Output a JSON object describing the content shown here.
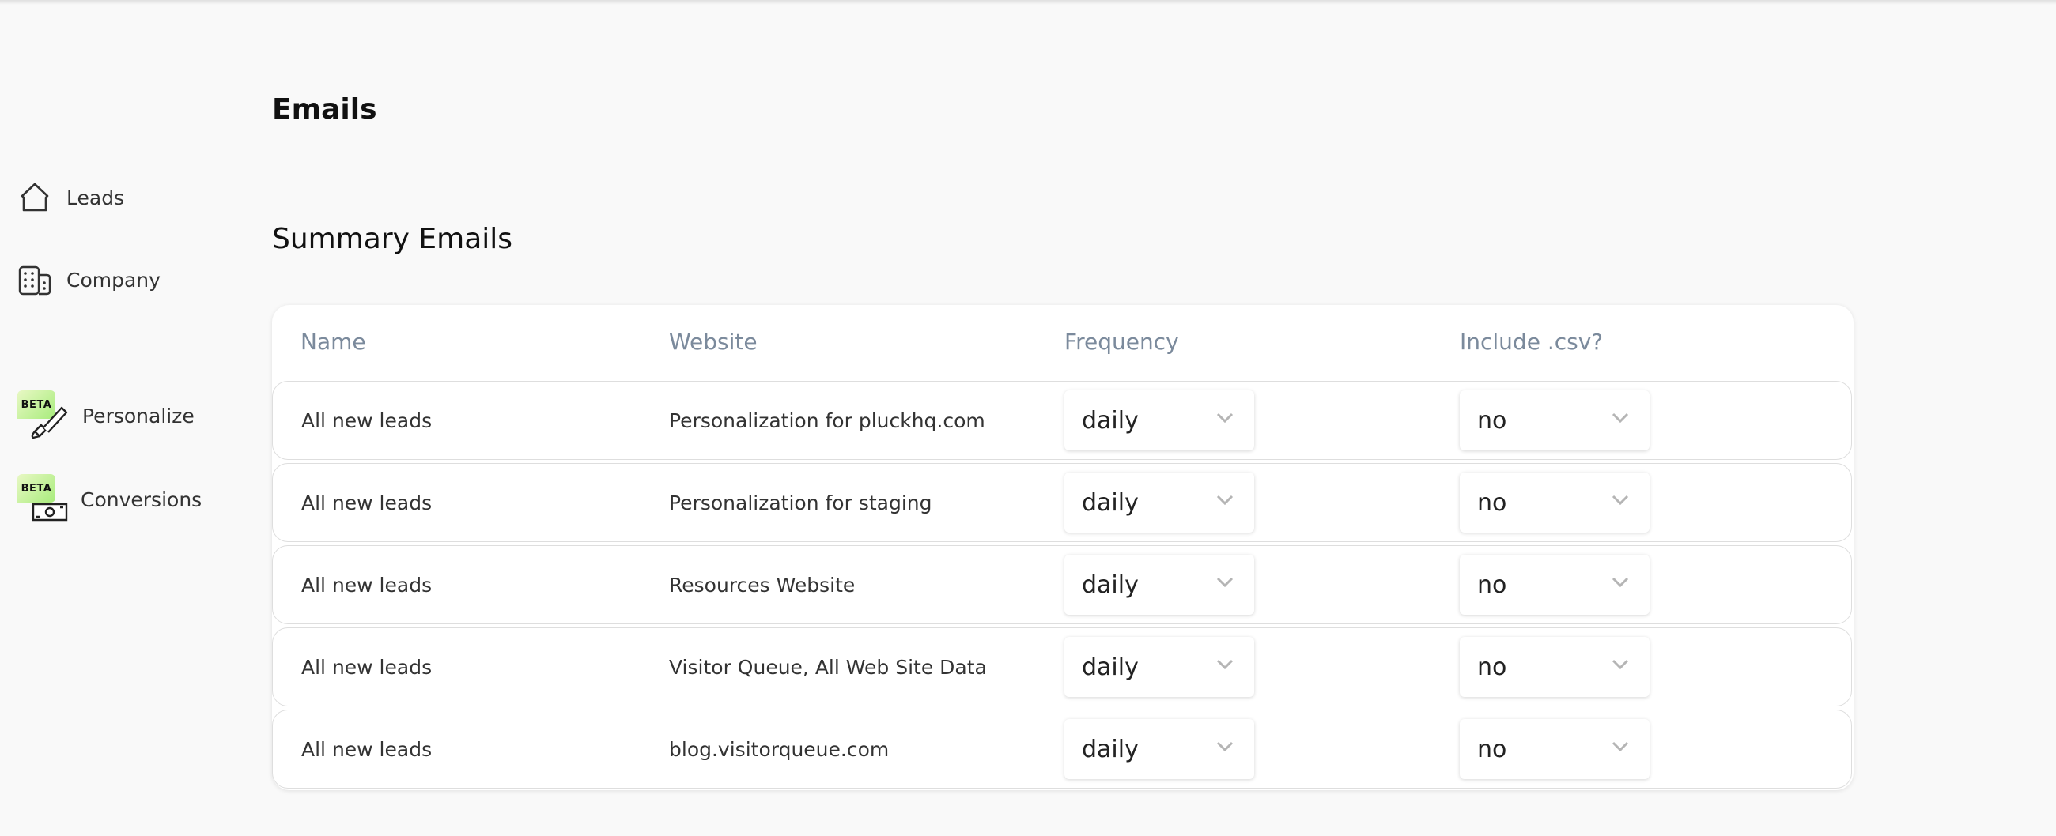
{
  "sidebar": {
    "items": [
      {
        "label": "Leads",
        "icon": "home-icon"
      },
      {
        "label": "Company",
        "icon": "building-icon"
      },
      {
        "label": "Personalize",
        "icon": "brush-icon",
        "badge": "BETA"
      },
      {
        "label": "Conversions",
        "icon": "money-icon",
        "badge": "BETA"
      }
    ]
  },
  "page": {
    "title": "Emails",
    "section_title": "Summary Emails"
  },
  "table": {
    "headers": [
      "Name",
      "Website",
      "Frequency",
      "Include .csv?"
    ],
    "rows": [
      {
        "name": "All new leads",
        "website": "Personalization for pluckhq.com",
        "frequency": "daily",
        "csv": "no"
      },
      {
        "name": "All new leads",
        "website": "Personalization for staging",
        "frequency": "daily",
        "csv": "no"
      },
      {
        "name": "All new leads",
        "website": "Resources Website",
        "frequency": "daily",
        "csv": "no"
      },
      {
        "name": "All new leads",
        "website": "Visitor Queue, All Web Site Data",
        "frequency": "daily",
        "csv": "no"
      },
      {
        "name": "All new leads",
        "website": "blog.visitorqueue.com",
        "frequency": "daily",
        "csv": "no"
      }
    ]
  },
  "colors": {
    "background": "#f9f9f9",
    "header_text": "#7b8a9c",
    "beta_badge": "#a8ec7c"
  }
}
